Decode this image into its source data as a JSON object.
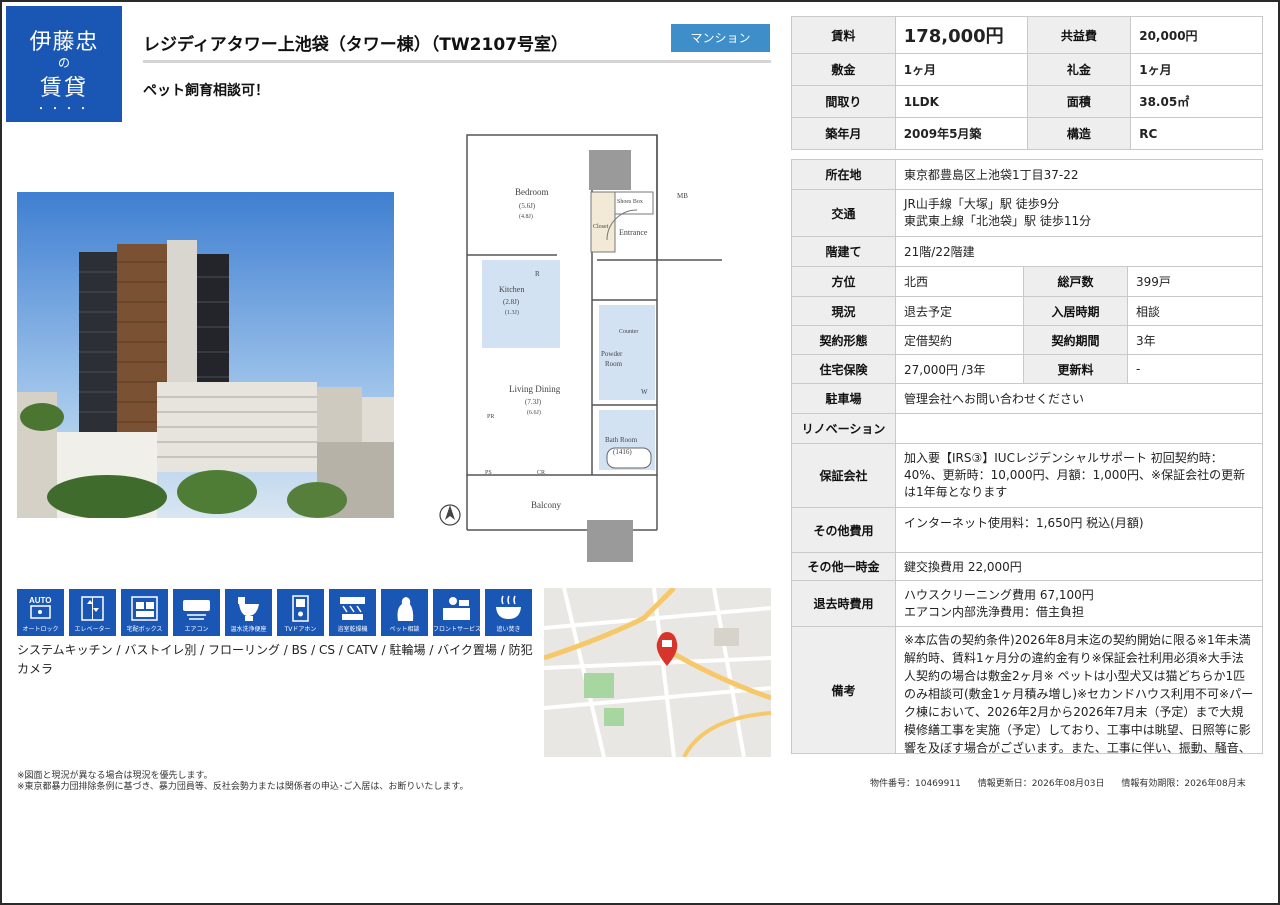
{
  "logo": {
    "line1": "伊藤忠",
    "line2": "の",
    "line3": "賃貸",
    "dots": "・・・・"
  },
  "header": {
    "title": "レジディアタワー上池袋（タワー棟）（TW2107号室）",
    "category_badge": "マンション",
    "pet_note": "ペット飼育相談可！"
  },
  "floor_plan": {
    "bedroom": "Bedroom",
    "bedroom_size": "(5.6J)",
    "bedroom_size2": "(4.8J)",
    "closet": "Closet",
    "shoes_box": "Shoes Box",
    "entrance": "Entrance",
    "mb": "MB",
    "kitchen": "Kitchen",
    "kitchen_size": "(2.8J)",
    "kitchen_size2": "(1.3J)",
    "r_label": "R",
    "counter": "Counter",
    "powder_room": "Powder",
    "powder_room2": "Room",
    "w_label": "W",
    "living": "Living Dining",
    "living_size": "(7.3J)",
    "living_size2": "(6.6J)",
    "pr": "PR",
    "bath": "Bath Room",
    "bath_size": "(1416)",
    "ps": "PS",
    "cr": "CR",
    "balcony": "Balcony"
  },
  "amenity_icons": [
    {
      "name": "auto-lock-icon",
      "caption": "オートロック"
    },
    {
      "name": "elevator-icon",
      "caption": "エレベーター"
    },
    {
      "name": "delivery-box-icon",
      "caption": "宅配ボックス"
    },
    {
      "name": "air-conditioner-icon",
      "caption": "エアコン"
    },
    {
      "name": "washlet-icon",
      "caption": "温水洗浄便座"
    },
    {
      "name": "tv-intercom-icon",
      "caption": "TVドアホン"
    },
    {
      "name": "bathroom-dryer-icon",
      "caption": "浴室乾燥機"
    },
    {
      "name": "pet-consult-icon",
      "caption": "ペット相談"
    },
    {
      "name": "front-service-icon",
      "caption": "フロントサービス"
    },
    {
      "name": "reheat-bath-icon",
      "caption": "追い焚き"
    }
  ],
  "amenity_autotext": "AUTO",
  "equipment": "システムキッチン / バストイレ別 / フローリング / BS / CS / CATV / 駐輪場 / バイク置場 / 防犯カメラ",
  "notes": {
    "line1": "※図面と現況が異なる場合は現況を優先します。",
    "line2": "※東京都暴力団排除条例に基づき、暴力団員等、反社会勢力または関係者の申込･ご入居は、お断りいたします。"
  },
  "summary": {
    "rent_label": "賃料",
    "rent_value": "178,000円",
    "common_fee_label": "共益費",
    "common_fee_value": "20,000円",
    "deposit_label": "敷金",
    "deposit_value": "1ヶ月",
    "key_money_label": "礼金",
    "key_money_value": "1ヶ月",
    "layout_label": "間取り",
    "layout_value": "1LDK",
    "area_label": "面積",
    "area_value": "38.05㎡",
    "built_label": "築年月",
    "built_value": "2009年5月築",
    "structure_label": "構造",
    "structure_value": "RC"
  },
  "details": {
    "address_label": "所在地",
    "address_value": "東京都豊島区上池袋1丁目37-22",
    "transport_label": "交通",
    "transport_line1": "JR山手線「大塚」駅 徒歩9分",
    "transport_line2": "東武東上線「北池袋」駅 徒歩11分",
    "floor_label": "階建て",
    "floor_value": "21階/22階建",
    "direction_label": "方位",
    "direction_value": "北西",
    "units_label": "総戸数",
    "units_value": "399戸",
    "status_label": "現況",
    "status_value": "退去予定",
    "move_in_label": "入居時期",
    "move_in_value": "相談",
    "contract_label": "契約形態",
    "contract_value": "定借契約",
    "term_label": "契約期間",
    "term_value": "3年",
    "insurance_label": "住宅保険",
    "insurance_value": "27,000円 /3年",
    "renewal_label": "更新料",
    "renewal_value": "-",
    "parking_label": "駐車場",
    "parking_value": "管理会社へお問い合わせください",
    "renovation_label": "リノベーション",
    "renovation_value": "",
    "guarantor_label": "保証会社",
    "guarantor_value": "加入要【IRS③】IUCレジデンシャルサポート 初回契約時：40%、更新時：10,000円、月額：1,000円、※保証会社の更新は1年毎となります",
    "other_fee_label": "その他費用",
    "other_fee_value": "インターネット使用料：1,650円 税込(月額)",
    "one_time_label": "その他一時金",
    "one_time_value": "鍵交換費用 22,000円",
    "move_out_label": "退去時費用",
    "move_out_line1": "ハウスクリーニング費用 67,100円",
    "move_out_line2": "エアコン内部洗浄費用：借主負担",
    "remarks_label": "備考",
    "remarks_value": "※本広告の契約条件)2026年8月末迄の契約開始に限る※1年未満解約時、賃料1ヶ月分の違約金有り※保証会社利用必須※大手法人契約の場合は敷金2ヶ月※ ペットは小型犬又は猫どちらか1匹のみ相談可(敷金1ヶ月積み増し)※セカンドハウス利用不可※パーク棟において、2026年2月から2026年7月末（予定）まで大規模修繕工事を実施（予定）しており、工事中は眺望、日照等に影響を及ぼす場合がございます。また、工事に伴い、振動、騒音、粉塵の飛散、臭"
  },
  "footer": {
    "property_no": "物件番号：10469911",
    "updated": "情報更新日：2026年08月03日",
    "valid_until": "情報有効期限：2026年08月末"
  },
  "colors": {
    "brand_blue": "#1a56b3",
    "badge_blue": "#3e8ec9",
    "label_bg": "#eeeeee",
    "map_pin": "#d8342c"
  }
}
